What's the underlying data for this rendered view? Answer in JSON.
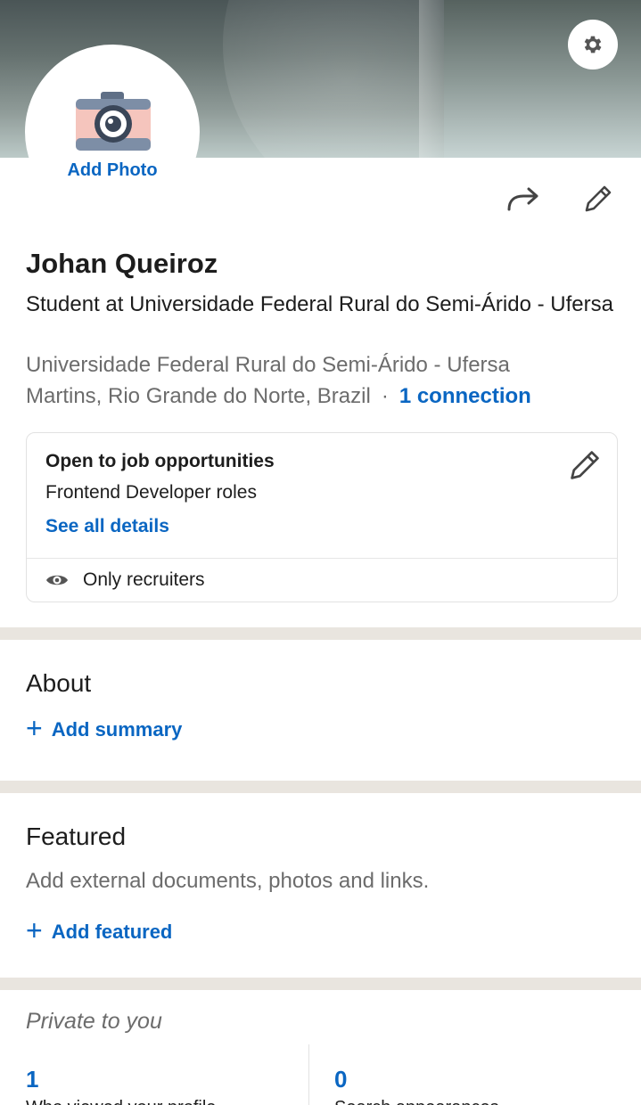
{
  "cover": {
    "settings_icon": "gear-icon"
  },
  "avatar": {
    "add_photo_label": "Add Photo",
    "icon": "camera-icon"
  },
  "actions": {
    "share_icon": "share-arrow-icon",
    "edit_icon": "pencil-icon"
  },
  "profile": {
    "name": "Johan Queiroz",
    "headline": "Student at Universidade Federal Rural do Semi-Árido - Ufersa",
    "school": "Universidade Federal Rural do Semi-Árido - Ufersa",
    "location": "Martins, Rio Grande do Norte, Brazil",
    "separator": "·",
    "connections": "1 connection"
  },
  "open_to_work": {
    "title": "Open to job opportunities",
    "roles": "Frontend Developer roles",
    "details_link": "See all details",
    "visibility": "Only recruiters",
    "edit_icon": "pencil-icon",
    "visibility_icon": "eye-icon"
  },
  "about": {
    "title": "About",
    "add_label": "Add summary",
    "add_symbol": "+"
  },
  "featured": {
    "title": "Featured",
    "description": "Add external documents, photos and links.",
    "add_label": "Add featured",
    "add_symbol": "+"
  },
  "private_section": {
    "title": "Private to you",
    "stats": [
      {
        "value": "1",
        "label": "Who viewed your profile"
      },
      {
        "value": "0",
        "label": "Search appearances"
      }
    ]
  },
  "colors": {
    "accent": "#0a66c2",
    "separator": "#e9e5df",
    "muted_text": "#6c6c6c"
  }
}
